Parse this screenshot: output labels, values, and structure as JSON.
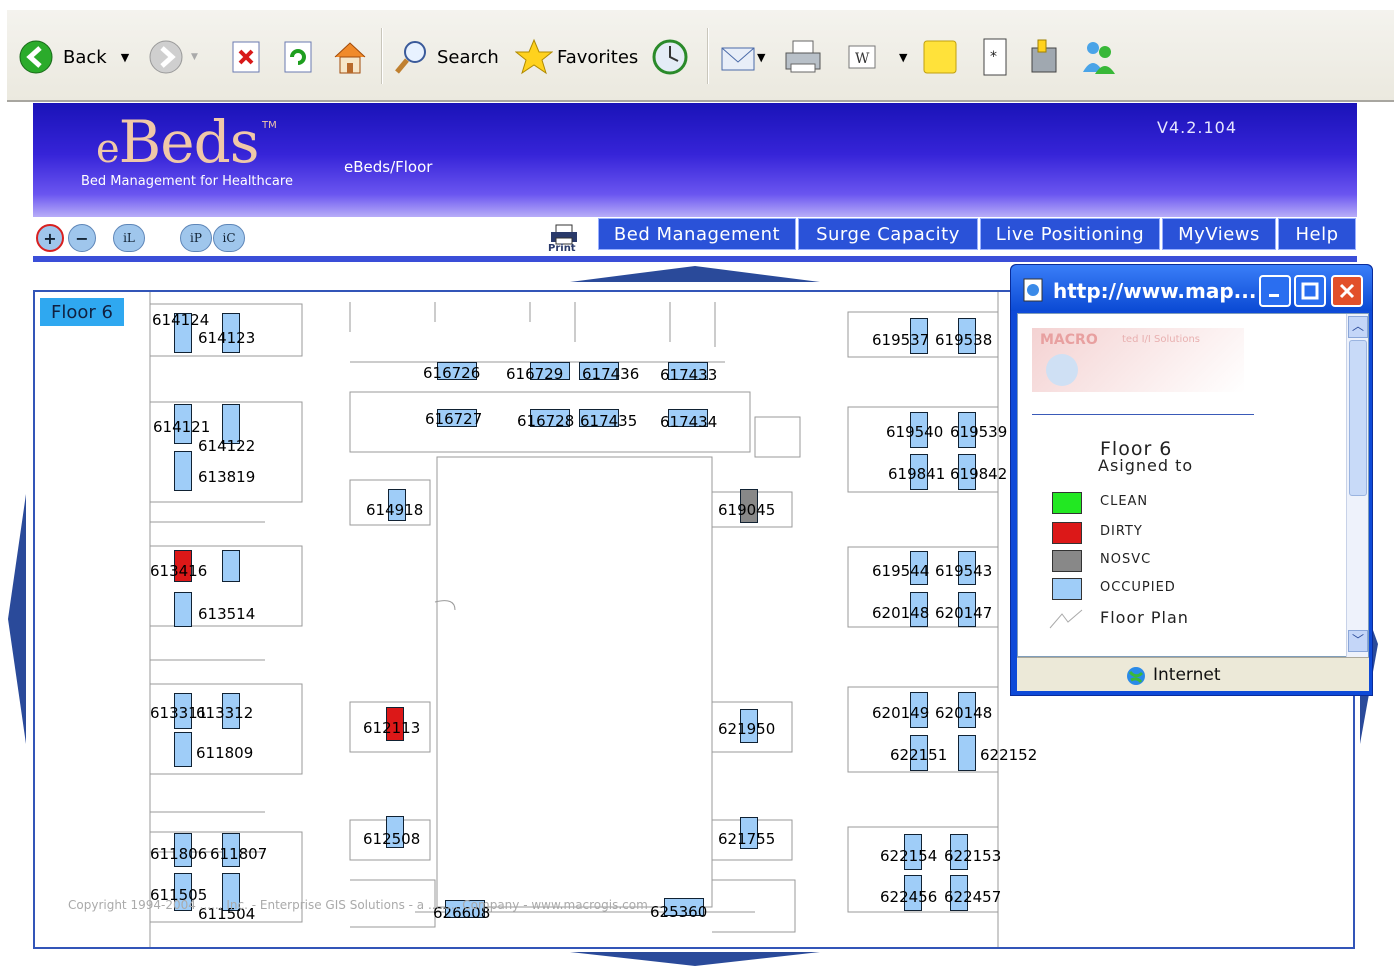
{
  "browser": {
    "back_label": "Back",
    "search_label": "Search",
    "favorites_label": "Favorites"
  },
  "app": {
    "logo_text": "Beds",
    "logo_e": "e",
    "trademark": "TM",
    "tagline": "Bed Management for Healthcare",
    "breadcrumb": "eBeds/Floor",
    "version": "V4.2.104",
    "print_label": "Print"
  },
  "nav": {
    "items": [
      "Bed Management",
      "Surge Capacity",
      "Live Positioning",
      "MyViews",
      "Help"
    ]
  },
  "tools": {
    "zoom_in": "+",
    "zoom_out": "−",
    "t1": "iL",
    "t2": "iP",
    "t3": "iC"
  },
  "map": {
    "floor_label": "Floor 6",
    "copyright": "Copyright 1994-2004 ...... Inc. - Enterprise GIS Solutions - a ........ Company - www.macrogis.com",
    "labels": [
      "614124",
      "614123",
      "614121",
      "614122",
      "613819",
      "613416",
      "613514",
      "613311",
      "613312",
      "611809",
      "611806",
      "611807",
      "611505",
      "611504",
      "616726",
      "616729",
      "617436",
      "617433",
      "616727",
      "616728",
      "617435",
      "617434",
      "614918",
      "612113",
      "612508",
      "626608",
      "625360",
      "619045",
      "621950",
      "621755",
      "619537",
      "619538",
      "619540",
      "619539",
      "619841",
      "619842",
      "619544",
      "619543",
      "620148",
      "620147",
      "620149",
      "620148",
      "622151",
      "622152",
      "622154",
      "622153",
      "622456",
      "622457"
    ]
  },
  "popup": {
    "title": "http://www.map...",
    "brand": "MACRO",
    "brand_sub": "ted I/I Solutions",
    "floor": "Floor 6",
    "assigned": "Asigned to",
    "legend": [
      {
        "label": "CLEAN",
        "color": "#22e822"
      },
      {
        "label": "DIRTY",
        "color": "#dc1818"
      },
      {
        "label": "NOSVC",
        "color": "#888888"
      },
      {
        "label": "OCCUPIED",
        "color": "#9fcdf8"
      },
      {
        "label": "Floor Plan",
        "color": ""
      }
    ],
    "status": "Internet"
  }
}
